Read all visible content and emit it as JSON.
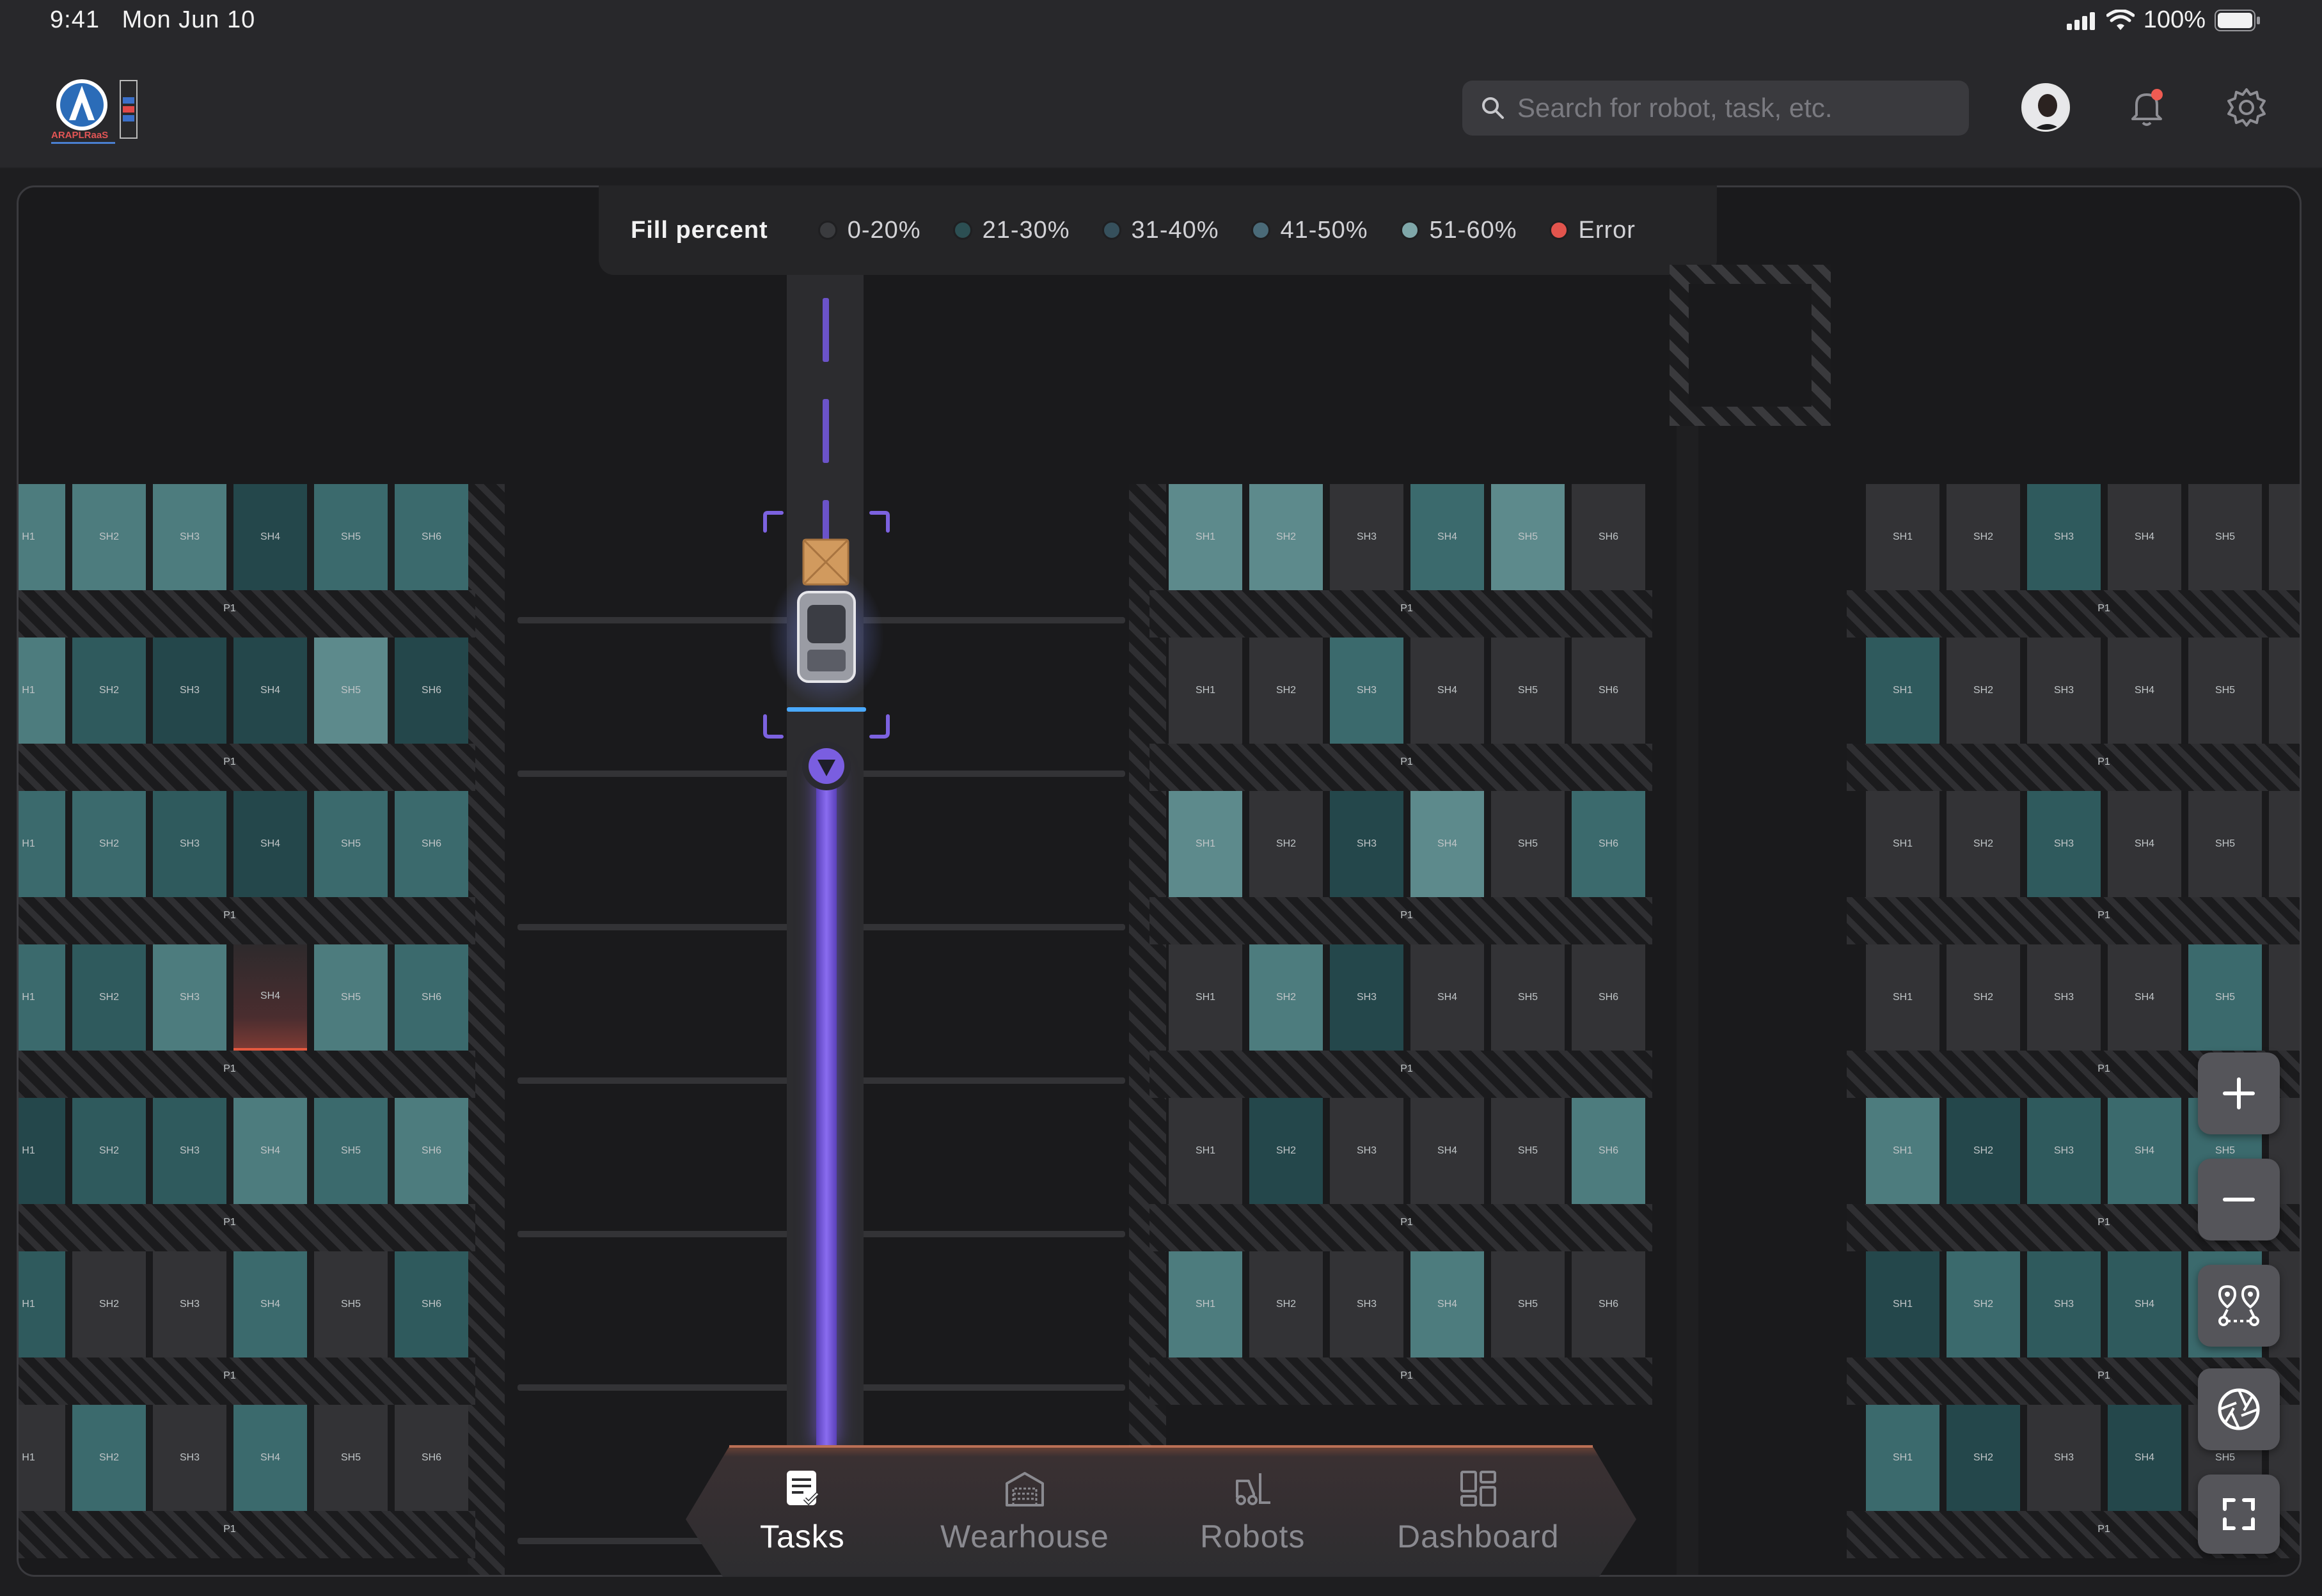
{
  "status_bar": {
    "time": "9:41",
    "date": "Mon Jun 10",
    "battery": "100%"
  },
  "header": {
    "logo_text": "ARAPLRaaS",
    "search_placeholder": "Search for robot, task, etc."
  },
  "legend": {
    "title": "Fill percent",
    "items": [
      {
        "label": "0-20%",
        "color": "#3a3b3e"
      },
      {
        "label": "21-30%",
        "color": "#2c4f53"
      },
      {
        "label": "31-40%",
        "color": "#36505c"
      },
      {
        "label": "41-50%",
        "color": "#4a6a78"
      },
      {
        "label": "51-60%",
        "color": "#7fa7a9"
      },
      {
        "label": "Error",
        "color": "#e2544d"
      }
    ]
  },
  "fill_colors": {
    "0": "#333336",
    "1": "#24474b",
    "2": "#2f5a5d",
    "3": "#3b6a6d",
    "4": "#4d7c7e",
    "5": "#5d8a8c",
    "e": "error"
  },
  "rack_groups": [
    {
      "id": "left",
      "labels": [
        "H1",
        "SH2",
        "SH3",
        "SH4",
        "SH5",
        "SH6"
      ],
      "rows": [
        {
          "fill": [
            "4",
            "4",
            "4",
            "1",
            "3",
            "3"
          ],
          "label": "P1"
        },
        {
          "fill": [
            "4",
            "2",
            "1",
            "1",
            "5",
            "1"
          ],
          "label": "P1"
        },
        {
          "fill": [
            "3",
            "3",
            "2",
            "1",
            "3",
            "3"
          ],
          "label": "P1"
        },
        {
          "fill": [
            "3",
            "2",
            "4",
            "e",
            "4",
            "3"
          ],
          "label": "P1"
        },
        {
          "fill": [
            "1",
            "2",
            "2",
            "4",
            "3",
            "4"
          ],
          "label": "P1"
        },
        {
          "fill": [
            "2",
            "0",
            "0",
            "3",
            "0",
            "2"
          ],
          "label": "P1"
        },
        {
          "fill": [
            "0",
            "3",
            "0",
            "3",
            "0",
            "0"
          ],
          "label": "P1"
        }
      ]
    },
    {
      "id": "middle",
      "labels": [
        "SH1",
        "SH2",
        "SH3",
        "SH4",
        "SH5",
        "SH6"
      ],
      "rows": [
        {
          "fill": [
            "5",
            "5",
            "0",
            "3",
            "5",
            "0"
          ],
          "label": "P1"
        },
        {
          "fill": [
            "0",
            "0",
            "3",
            "0",
            "0",
            "0"
          ],
          "label": "P1"
        },
        {
          "fill": [
            "5",
            "0",
            "1",
            "5",
            "0",
            "3"
          ],
          "label": "P1"
        },
        {
          "fill": [
            "0",
            "4",
            "1",
            "0",
            "0",
            "0"
          ],
          "label": "P1"
        },
        {
          "fill": [
            "0",
            "1",
            "0",
            "0",
            "0",
            "4"
          ],
          "label": "P1"
        },
        {
          "fill": [
            "4",
            "0",
            "0",
            "4",
            "0",
            "0"
          ],
          "label": "P1"
        }
      ]
    },
    {
      "id": "right",
      "labels": [
        "SH1",
        "SH2",
        "SH3",
        "SH4",
        "SH5",
        "S"
      ],
      "rows": [
        {
          "fill": [
            "0",
            "0",
            "2",
            "0",
            "0",
            "0"
          ],
          "label": "P1"
        },
        {
          "fill": [
            "2",
            "0",
            "0",
            "0",
            "0",
            "0"
          ],
          "label": "P1"
        },
        {
          "fill": [
            "0",
            "0",
            "2",
            "0",
            "0",
            "0"
          ],
          "label": "P1"
        },
        {
          "fill": [
            "0",
            "0",
            "0",
            "0",
            "3",
            "0"
          ],
          "label": "P1"
        },
        {
          "fill": [
            "4",
            "1",
            "2",
            "3",
            "3",
            "0"
          ],
          "label": "P1"
        },
        {
          "fill": [
            "1",
            "3",
            "2",
            "2",
            "3",
            "0"
          ],
          "label": "P1"
        },
        {
          "fill": [
            "3",
            "1",
            "0",
            "1",
            "0",
            "0"
          ],
          "label": "P1"
        }
      ]
    }
  ],
  "nav": {
    "items": [
      {
        "label": "Tasks",
        "active": true
      },
      {
        "label": "Wearhouse",
        "active": false
      },
      {
        "label": "Robots",
        "active": false
      },
      {
        "label": "Dashboard",
        "active": false
      }
    ]
  }
}
